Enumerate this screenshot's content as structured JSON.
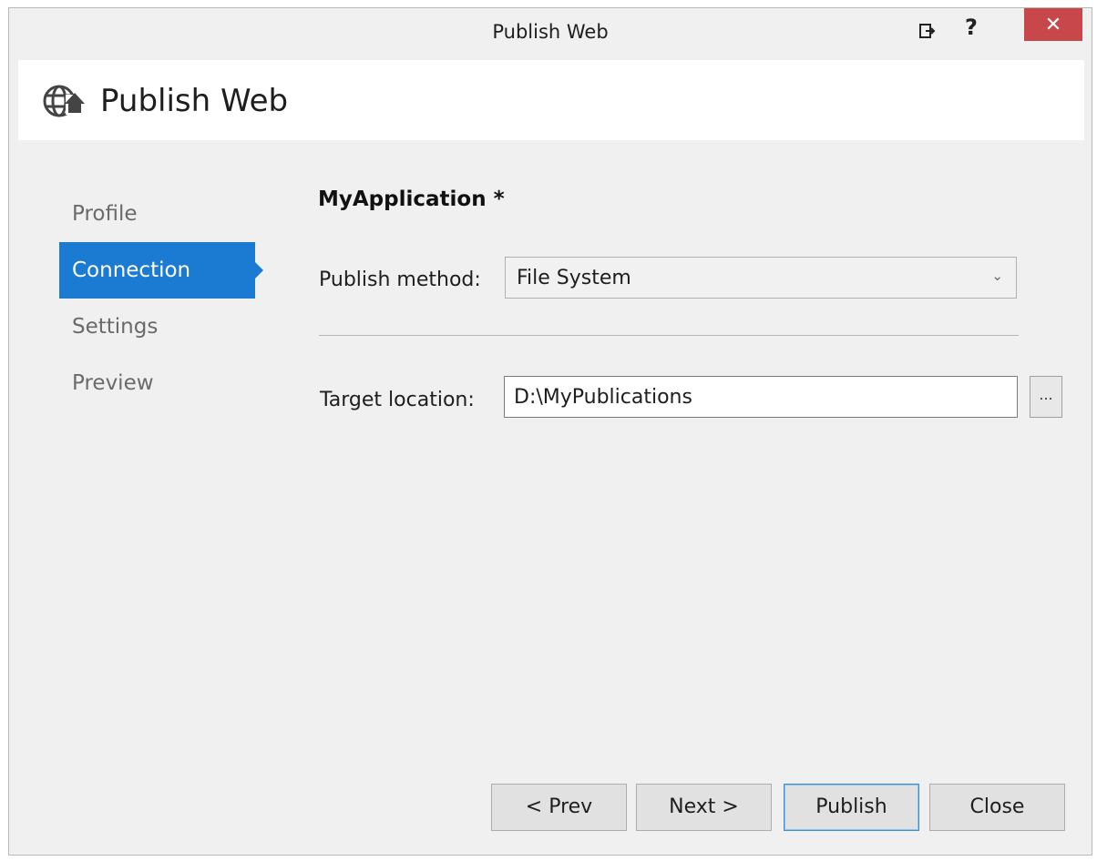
{
  "window": {
    "title": "Publish Web",
    "help_label": "?",
    "close_label": "✕"
  },
  "header": {
    "title": "Publish Web",
    "icon": "globe-upload-icon"
  },
  "sidebar": {
    "items": [
      {
        "label": "Profile"
      },
      {
        "label": "Connection"
      },
      {
        "label": "Settings"
      },
      {
        "label": "Preview"
      }
    ],
    "active": "Connection"
  },
  "main": {
    "profile_name": "MyApplication *",
    "publish_method": {
      "label": "Publish method:",
      "value": "File System"
    },
    "target_location": {
      "label": "Target location:",
      "value": "D:\\MyPublications",
      "browse_label": "..."
    }
  },
  "footer": {
    "prev_label": "< Prev",
    "next_label": "Next >",
    "publish_label": "Publish",
    "close_label": "Close"
  },
  "colors": {
    "accent": "#1b7ad1",
    "close_button": "#c7474a"
  }
}
